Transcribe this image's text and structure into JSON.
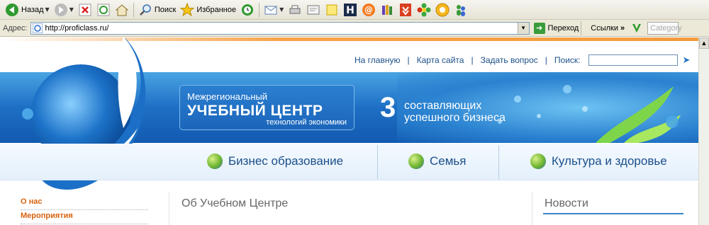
{
  "toolbar": {
    "back_label": "Назад",
    "search_label": "Поиск",
    "favorites_label": "Избранное"
  },
  "addressbar": {
    "label": "Адрес:",
    "url": "http://proficlass.ru/",
    "go_label": "Переход",
    "links_label": "Ссылки",
    "category_placeholder": "Category"
  },
  "page": {
    "topnav": {
      "home": "На главную",
      "sitemap": "Карта сайта",
      "ask": "Задать вопрос",
      "search_label": "Поиск:"
    },
    "banner": {
      "line1": "Межрегиональный",
      "line2": "УЧЕБНЫЙ ЦЕНТР",
      "line3": "технологий экономики",
      "number": "3",
      "slogan1": "составляющих",
      "slogan2": "успешного бизнеса"
    },
    "sections": [
      "Бизнес образование",
      "Семья",
      "Культура и здоровье"
    ],
    "leftmenu": [
      "О нас",
      "Мероприятия"
    ],
    "content_title": "Об Учебном Центре",
    "news_title": "Новости"
  },
  "colors": {
    "link": "#1b4f8a",
    "menu_orange": "#d9630f",
    "banner_blue": "#1d6fc5",
    "accent_orange": "#f39c3f"
  }
}
